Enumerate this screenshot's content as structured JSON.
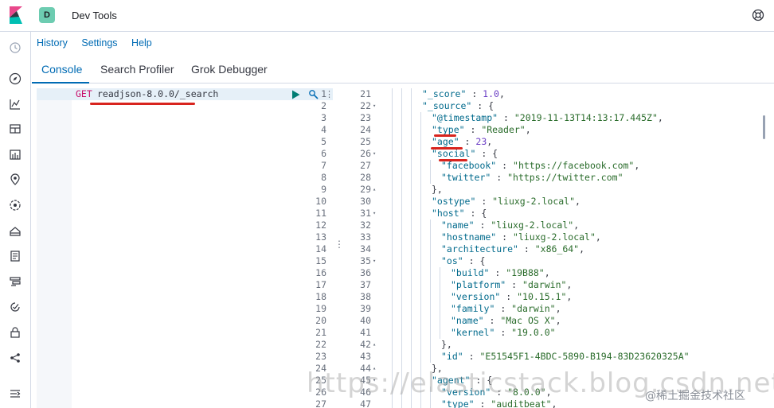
{
  "header": {
    "space_initial": "D",
    "title": "Dev Tools"
  },
  "subnav": {
    "items": [
      "History",
      "Settings",
      "Help"
    ]
  },
  "tabs": [
    "Console",
    "Search Profiler",
    "Grok Debugger"
  ],
  "request": {
    "method": "GET",
    "path": "readjson-8.0.0/_search",
    "line_numbers": [
      "1",
      "2",
      "3",
      "4",
      "5",
      "6",
      "7",
      "8",
      "9",
      "10",
      "11",
      "12",
      "13",
      "14",
      "15",
      "16",
      "17",
      "18",
      "19",
      "20",
      "21",
      "22",
      "23",
      "24",
      "25",
      "26",
      "27"
    ]
  },
  "response": {
    "lines": [
      {
        "n": "21",
        "fold": "",
        "indent": 3,
        "text": "\"_score\" : 1.0,"
      },
      {
        "n": "22",
        "fold": "▾",
        "indent": 3,
        "text": "\"_source\" : {"
      },
      {
        "n": "23",
        "fold": "",
        "indent": 4,
        "text": "\"@timestamp\" : \"2019-11-13T14:13:17.445Z\","
      },
      {
        "n": "24",
        "fold": "",
        "indent": 4,
        "text": "\"type\" : \"Reader\","
      },
      {
        "n": "25",
        "fold": "",
        "indent": 4,
        "text": "\"age\" : 23,"
      },
      {
        "n": "26",
        "fold": "▾",
        "indent": 4,
        "text": "\"social\" : {"
      },
      {
        "n": "27",
        "fold": "",
        "indent": 5,
        "text": "\"facebook\" : \"https://facebook.com\","
      },
      {
        "n": "28",
        "fold": "",
        "indent": 5,
        "text": "\"twitter\" : \"https://twitter.com\""
      },
      {
        "n": "29",
        "fold": "▴",
        "indent": 4,
        "text": "},"
      },
      {
        "n": "30",
        "fold": "",
        "indent": 4,
        "text": "\"ostype\" : \"liuxg-2.local\","
      },
      {
        "n": "31",
        "fold": "▾",
        "indent": 4,
        "text": "\"host\" : {"
      },
      {
        "n": "32",
        "fold": "",
        "indent": 5,
        "text": "\"name\" : \"liuxg-2.local\","
      },
      {
        "n": "33",
        "fold": "",
        "indent": 5,
        "text": "\"hostname\" : \"liuxg-2.local\","
      },
      {
        "n": "34",
        "fold": "",
        "indent": 5,
        "text": "\"architecture\" : \"x86_64\","
      },
      {
        "n": "35",
        "fold": "▾",
        "indent": 5,
        "text": "\"os\" : {"
      },
      {
        "n": "36",
        "fold": "",
        "indent": 6,
        "text": "\"build\" : \"19B88\","
      },
      {
        "n": "37",
        "fold": "",
        "indent": 6,
        "text": "\"platform\" : \"darwin\","
      },
      {
        "n": "38",
        "fold": "",
        "indent": 6,
        "text": "\"version\" : \"10.15.1\","
      },
      {
        "n": "39",
        "fold": "",
        "indent": 6,
        "text": "\"family\" : \"darwin\","
      },
      {
        "n": "40",
        "fold": "",
        "indent": 6,
        "text": "\"name\" : \"Mac OS X\","
      },
      {
        "n": "41",
        "fold": "",
        "indent": 6,
        "text": "\"kernel\" : \"19.0.0\""
      },
      {
        "n": "42",
        "fold": "▴",
        "indent": 5,
        "text": "},"
      },
      {
        "n": "43",
        "fold": "",
        "indent": 5,
        "text": "\"id\" : \"E51545F1-4BDC-5890-B194-83D23620325A\""
      },
      {
        "n": "44",
        "fold": "▴",
        "indent": 4,
        "text": "},"
      },
      {
        "n": "45",
        "fold": "▾",
        "indent": 4,
        "text": "\"agent\" : {"
      },
      {
        "n": "46",
        "fold": "",
        "indent": 5,
        "text": "\"version\" : \"8.0.0\","
      },
      {
        "n": "47",
        "fold": "",
        "indent": 5,
        "text": "\"type\" : \"auditbeat\","
      }
    ]
  },
  "watermark": {
    "url": "https://elasticstack.blog.csdn.net",
    "credit": "@稀土掘金技术社区"
  },
  "colors": {
    "accent": "#006bb4",
    "method": "#c80a68",
    "annotation": "#d8241e"
  }
}
